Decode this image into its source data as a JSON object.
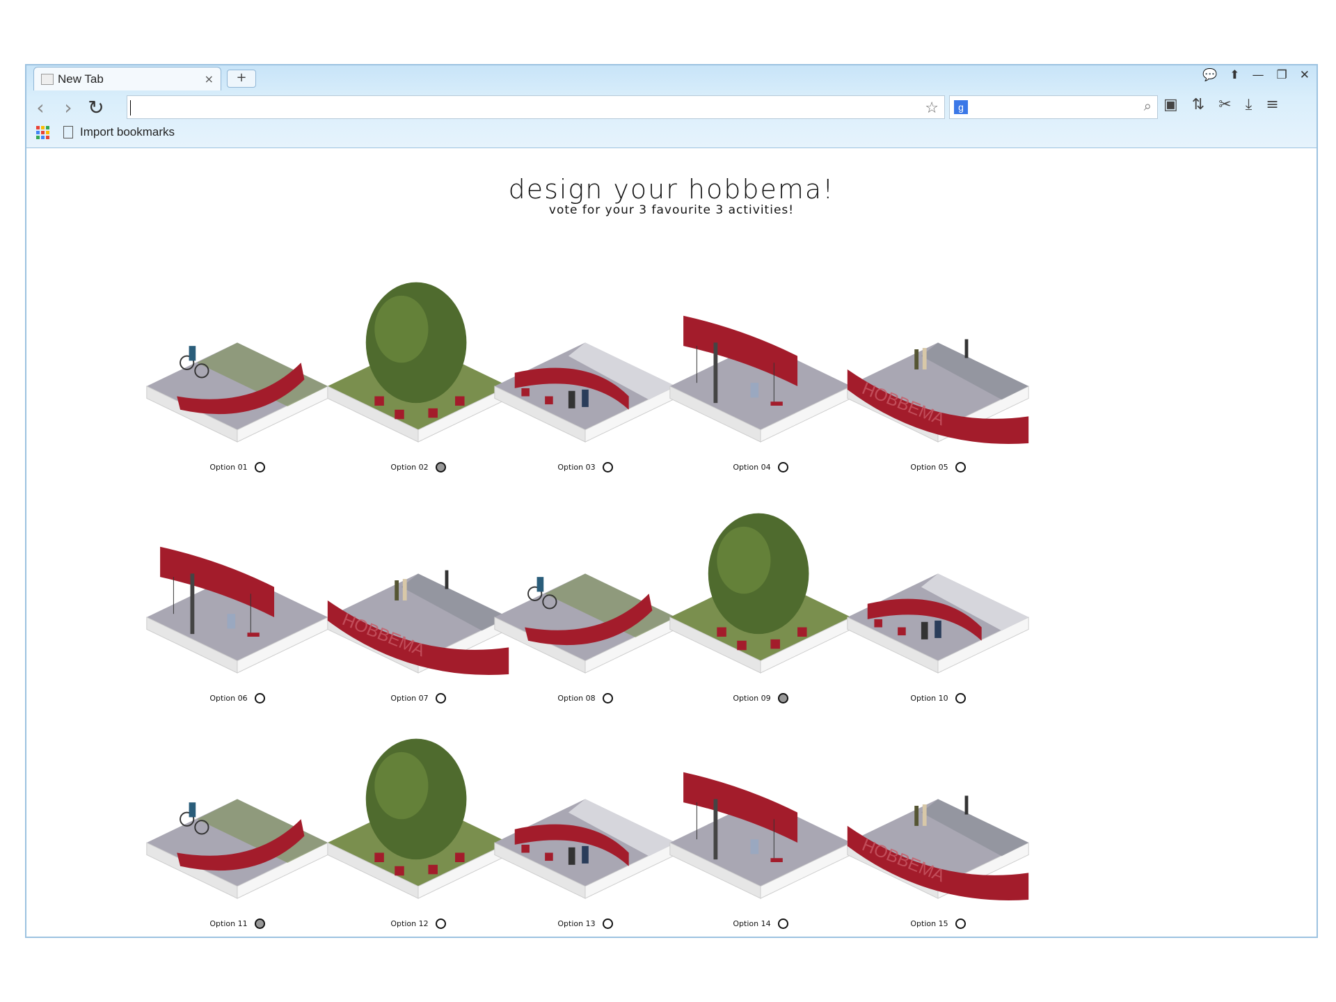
{
  "browser": {
    "tab_title": "New Tab",
    "new_tab_label": "+",
    "tab_close": "×",
    "window_controls": [
      "💬",
      "⬆",
      "—",
      "❐",
      "✕"
    ],
    "address_value": "",
    "bookmark_label": "Import bookmarks",
    "search_engine_letter": "g"
  },
  "page": {
    "title": "design your hobbema!",
    "subtitle": "vote for your 3 favourite 3 activities!"
  },
  "options": [
    {
      "label": "Option 01",
      "scene": "bike",
      "selected": false
    },
    {
      "label": "Option 02",
      "scene": "tree",
      "selected": true
    },
    {
      "label": "Option 03",
      "scene": "bench",
      "selected": false
    },
    {
      "label": "Option 04",
      "scene": "swing",
      "selected": false
    },
    {
      "label": "Option 05",
      "scene": "sign",
      "selected": false
    },
    {
      "label": "Option 06",
      "scene": "swing",
      "selected": false
    },
    {
      "label": "Option 07",
      "scene": "sign",
      "selected": false
    },
    {
      "label": "Option 08",
      "scene": "bike",
      "selected": false
    },
    {
      "label": "Option 09",
      "scene": "tree",
      "selected": true
    },
    {
      "label": "Option 10",
      "scene": "bench",
      "selected": false
    },
    {
      "label": "Option 11",
      "scene": "bike",
      "selected": true
    },
    {
      "label": "Option 12",
      "scene": "tree",
      "selected": false
    },
    {
      "label": "Option 13",
      "scene": "bench",
      "selected": false
    },
    {
      "label": "Option 14",
      "scene": "swing",
      "selected": false
    },
    {
      "label": "Option 15",
      "scene": "sign",
      "selected": false
    }
  ],
  "sign_text": "HOBBEMA",
  "colors": {
    "accent_red": "#a31c2b",
    "paving": "#a9a7b3",
    "grass": "#7a8f4e",
    "tree": "#4f6b2e"
  }
}
